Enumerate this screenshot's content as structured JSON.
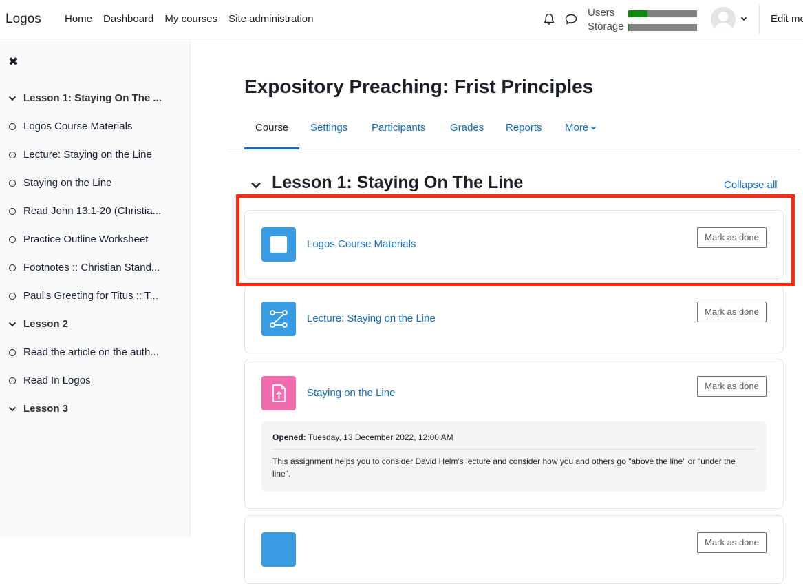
{
  "navbar": {
    "brand": "Logos",
    "links": [
      "Home",
      "Dashboard",
      "My courses",
      "Site administration"
    ],
    "quota": {
      "users_label": "Users",
      "users_fill": 0.28,
      "storage_label": "Storage",
      "storage_fill": 0.01,
      "fill_color": "#0f8a0f",
      "track_color": "#808080"
    },
    "edit_mode": "Edit mo"
  },
  "drawer": {
    "close_icon": "close-icon",
    "items": [
      {
        "type": "section",
        "label": "Lesson 1: Staying On The ..."
      },
      {
        "type": "activity",
        "label": "Logos Course Materials"
      },
      {
        "type": "activity",
        "label": "Lecture: Staying on the Line"
      },
      {
        "type": "activity",
        "label": "Staying on the Line"
      },
      {
        "type": "activity",
        "label": "Read John 13:1-20 (Christia..."
      },
      {
        "type": "activity",
        "label": "Practice Outline Worksheet"
      },
      {
        "type": "activity",
        "label": "Footnotes :: Christian Stand..."
      },
      {
        "type": "activity",
        "label": "Paul's Greeting for Titus :: T..."
      },
      {
        "type": "section",
        "label": "Lesson 2"
      },
      {
        "type": "activity",
        "label": "Read the article on the auth..."
      },
      {
        "type": "activity",
        "label": "Read In Logos"
      },
      {
        "type": "section",
        "label": "Lesson 3"
      }
    ]
  },
  "course": {
    "title": "Expository Preaching: Frist Principles",
    "tabs": [
      "Course",
      "Settings",
      "Participants",
      "Grades",
      "Reports",
      "More"
    ],
    "active_tab": "Course"
  },
  "section": {
    "title": "Lesson 1: Staying On The Line",
    "collapse_all": "Collapse all"
  },
  "activities": [
    {
      "name": "Logos Course Materials",
      "icon": "page-icon",
      "icon_color": "#399be2",
      "button": "Mark as done"
    },
    {
      "name": "Lecture: Staying on the Line",
      "icon": "flow-icon",
      "icon_color": "#399be2",
      "button": "Mark as done"
    },
    {
      "name": "Staying on the Line",
      "icon": "assignment-upload-icon",
      "icon_color": "#f06cac",
      "button": "Mark as done",
      "opened_label": "Opened:",
      "opened_date": "Tuesday, 13 December 2022, 12:00 AM",
      "description": "This assignment helps you to consider David Helm's lecture and consider how you and others go \"above the line\" or \"under the line\"."
    },
    {
      "name": "",
      "icon": "page-icon",
      "icon_color": "#399be2",
      "button": "Mark as done"
    }
  ],
  "colors": {
    "link": "#0f6cbf",
    "highlight": "#ff2a12"
  }
}
